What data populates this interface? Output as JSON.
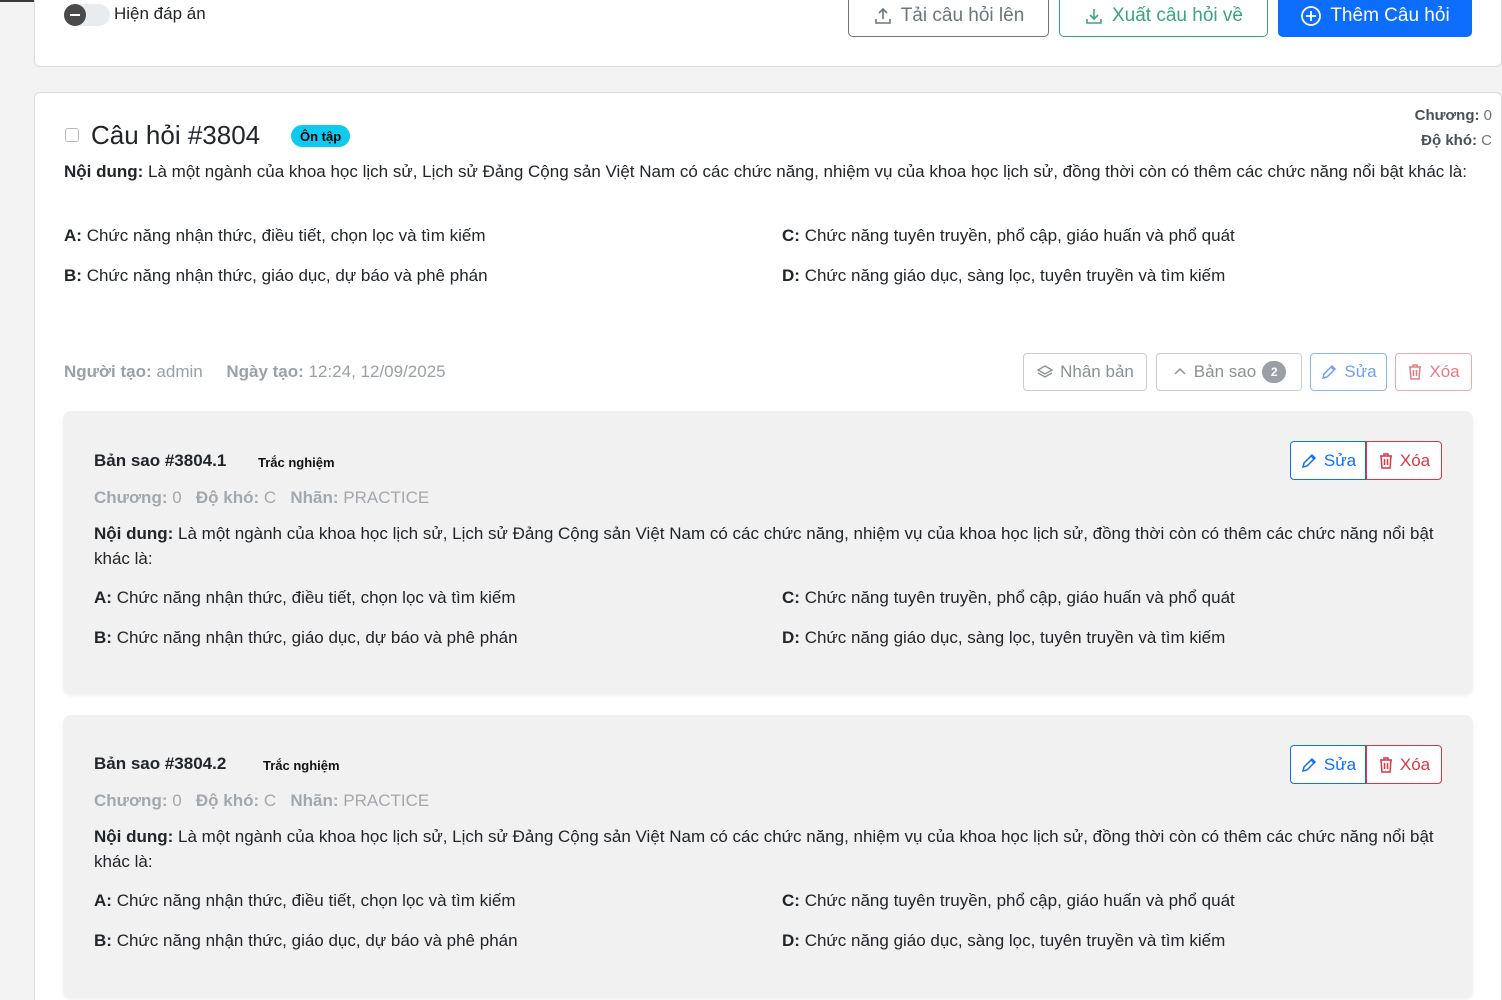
{
  "toolbar": {
    "toggle_label": "Hiện đáp án",
    "upload_label": "Tải câu hỏi lên",
    "export_label": "Xuất câu hỏi về",
    "add_label": "Thêm Câu hỏi"
  },
  "question": {
    "title": "Câu hỏi #3804",
    "badge": "Ôn tập",
    "chapter_label": "Chương:",
    "chapter_value": "0",
    "difficulty_label": "Độ khó:",
    "difficulty_value": "C",
    "content_label": "Nội dung:",
    "content_text": "Là một ngành của khoa học lịch sử, Lịch sử Đảng Cộng sản Việt Nam có các chức năng, nhiệm vụ của khoa học lịch sử, đồng thời còn có thêm các chức năng nổi bật khác là:",
    "options": [
      {
        "key": "A:",
        "text": "Chức năng nhận thức, điều tiết, chọn lọc và tìm kiếm"
      },
      {
        "key": "B:",
        "text": "Chức năng nhận thức, giáo dục, dự báo và phê phán"
      },
      {
        "key": "C:",
        "text": "Chức năng tuyên truyền, phổ cập, giáo huấn và phổ quát"
      },
      {
        "key": "D:",
        "text": "Chức năng giáo dục, sàng lọc, tuyên truyền và tìm kiếm"
      }
    ],
    "creator_label": "Người tạo:",
    "creator_value": "admin",
    "date_label": "Ngày tạo:",
    "date_value": "12:24, 12/09/2025",
    "actions": {
      "duplicate": "Nhân bản",
      "copies": "Bản sao",
      "copies_count": "2",
      "edit": "Sửa",
      "delete": "Xóa"
    }
  },
  "copies": [
    {
      "title": "Bản sao #3804.1",
      "type": "Trắc nghiệm",
      "chapter_label": "Chương:",
      "chapter_value": "0",
      "difficulty_label": "Độ khó:",
      "difficulty_value": "C",
      "tag_label": "Nhãn:",
      "tag_value": "PRACTICE",
      "content_label": "Nội dung:",
      "content_text": "Là một ngành của khoa học lịch sử, Lịch sử Đảng Cộng sản Việt Nam có các chức năng, nhiệm vụ của khoa học lịch sử, đồng thời còn có thêm các chức năng nổi bật khác là:",
      "options": [
        {
          "key": "A:",
          "text": "Chức năng nhận thức, điều tiết, chọn lọc và tìm kiếm"
        },
        {
          "key": "B:",
          "text": "Chức năng nhận thức, giáo dục, dự báo và phê phán"
        },
        {
          "key": "C:",
          "text": "Chức năng tuyên truyền, phổ cập, giáo huấn và phổ quát"
        },
        {
          "key": "D:",
          "text": "Chức năng giáo dục, sàng lọc, tuyên truyền và tìm kiếm"
        }
      ],
      "edit": "Sửa",
      "delete": "Xóa"
    },
    {
      "title": "Bản sao #3804.2",
      "type": "Trắc nghiệm",
      "chapter_label": "Chương:",
      "chapter_value": "0",
      "difficulty_label": "Độ khó:",
      "difficulty_value": "C",
      "tag_label": "Nhãn:",
      "tag_value": "PRACTICE",
      "content_label": "Nội dung:",
      "content_text": "Là một ngành của khoa học lịch sử, Lịch sử Đảng Cộng sản Việt Nam có các chức năng, nhiệm vụ của khoa học lịch sử, đồng thời còn có thêm các chức năng nổi bật khác là:",
      "options": [
        {
          "key": "A:",
          "text": "Chức năng nhận thức, điều tiết, chọn lọc và tìm kiếm"
        },
        {
          "key": "B:",
          "text": "Chức năng nhận thức, giáo dục, dự báo và phê phán"
        },
        {
          "key": "C:",
          "text": "Chức năng tuyên truyền, phổ cập, giáo huấn và phổ quát"
        },
        {
          "key": "D:",
          "text": "Chức năng giáo dục, sàng lọc, tuyên truyền và tìm kiếm"
        }
      ],
      "edit": "Sửa",
      "delete": "Xóa"
    }
  ]
}
